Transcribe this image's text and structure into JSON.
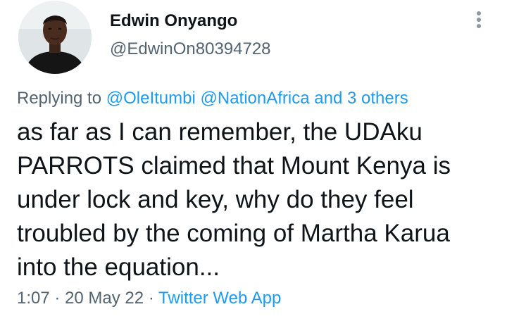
{
  "author": {
    "name": "Edwin Onyango",
    "handle": "@EdwinOn80394728"
  },
  "icons": {
    "avatar": "profile-photo",
    "more": "more-vertical-icon"
  },
  "reply": {
    "prefix": "Replying to",
    "mention_1": "@OleItumbi",
    "mention_2": "@NationAfrica",
    "others": "and 3 others"
  },
  "tweet": {
    "lines": [
      "as far as I can remember, the UDAku",
      "PARROTS claimed that Mount Kenya is",
      "under lock and key, why do they feel",
      "troubled by the coming of Martha Karua",
      "into the equation..."
    ]
  },
  "meta": {
    "time": "1:07",
    "separator": "·",
    "date": "20 May 22",
    "source": "Twitter Web App"
  },
  "colors": {
    "link": "#1d9bf0",
    "secondary_text": "#536471",
    "primary_text": "#0f1419"
  }
}
